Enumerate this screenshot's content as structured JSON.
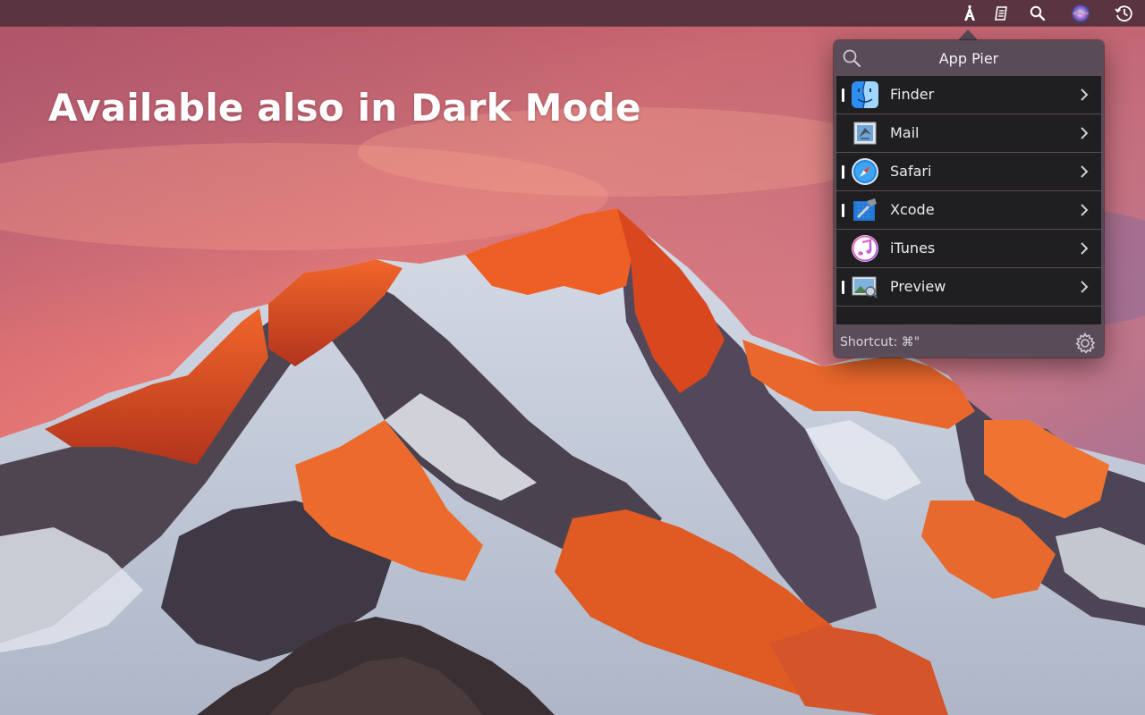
{
  "headline": "Available also in Dark Mode",
  "menubar": {
    "icons": [
      "app-pier-icon",
      "notes-icon",
      "spotlight-search-icon",
      "siri-icon",
      "time-machine-icon"
    ]
  },
  "popover": {
    "title": "App Pier",
    "apps": [
      {
        "name": "Finder",
        "icon": "finder-icon",
        "running": true
      },
      {
        "name": "Mail",
        "icon": "mail-icon",
        "running": false
      },
      {
        "name": "Safari",
        "icon": "safari-icon",
        "running": true
      },
      {
        "name": "Xcode",
        "icon": "xcode-icon",
        "running": true
      },
      {
        "name": "iTunes",
        "icon": "itunes-icon",
        "running": false
      },
      {
        "name": "Preview",
        "icon": "preview-icon",
        "running": true
      }
    ],
    "shortcut": "Shortcut: ⌘\""
  },
  "colors": {
    "menubar": "#5a3440",
    "popover": "#544a56",
    "row": "#1f1f21",
    "text": "#ececec"
  }
}
